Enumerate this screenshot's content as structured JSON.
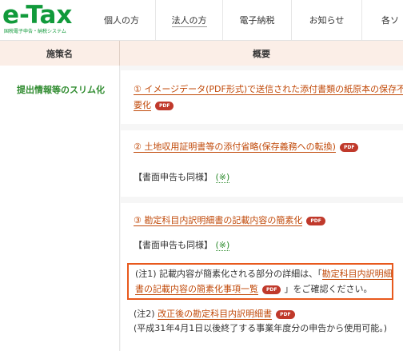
{
  "header": {
    "logo": {
      "title": "e-Tax",
      "subtitle": "国税電子申告・納税システム"
    },
    "nav": [
      "個人の方",
      "法人の方",
      "電子納税",
      "お知らせ",
      "各ソ"
    ]
  },
  "table": {
    "col_name_header": "施策名",
    "col_overview_header": "概要",
    "measure_name": "提出情報等のスリム化",
    "pdf_badge": "PDF",
    "items": [
      {
        "link_line1": "① イメージデータ(PDF形式)で送信された添付書類の紙原本の保存不",
        "link_line2": "要化"
      },
      {
        "link": "② 土地収用証明書等の添付省略(保存義務への転換)",
        "note_prefix": "【書面申告も同様】",
        "note_link": "(※)"
      },
      {
        "link": "③ 勘定科目内訳明細書の記載内容の簡素化",
        "note_prefix": "【書面申告も同様】",
        "note_link": "(※)",
        "box_line1_pre": "(注1) 記載内容が簡素化される部分の詳細は、「",
        "box_line1_link": "勘定科目内訳明細",
        "box_line2_link": "書の記載内容の簡素化事項一覧",
        "box_line2_post": "」をご確認ください。",
        "note2_pre": "(注2) ",
        "note2_link": "改正後の勘定科目内訳明細書",
        "note2_sub": "(平成31年4月1日以後終了する事業年度分の申告から使用可能。)"
      }
    ]
  }
}
